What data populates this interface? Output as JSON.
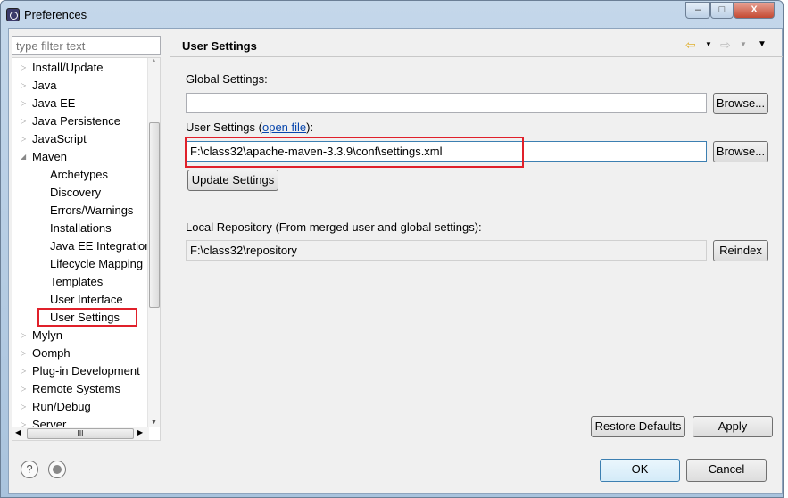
{
  "window": {
    "title": "Preferences",
    "minimize": "‒",
    "maximize": "□",
    "close": "X"
  },
  "filter": {
    "placeholder": "type filter text"
  },
  "tree": {
    "items": [
      {
        "label": "Install/Update",
        "level": 0,
        "expanded": false
      },
      {
        "label": "Java",
        "level": 0,
        "expanded": false
      },
      {
        "label": "Java EE",
        "level": 0,
        "expanded": false
      },
      {
        "label": "Java Persistence",
        "level": 0,
        "expanded": false
      },
      {
        "label": "JavaScript",
        "level": 0,
        "expanded": false
      },
      {
        "label": "Maven",
        "level": 0,
        "expanded": true
      },
      {
        "label": "Archetypes",
        "level": 1
      },
      {
        "label": "Discovery",
        "level": 1
      },
      {
        "label": "Errors/Warnings",
        "level": 1
      },
      {
        "label": "Installations",
        "level": 1
      },
      {
        "label": "Java EE Integration",
        "level": 1
      },
      {
        "label": "Lifecycle Mapping",
        "level": 1
      },
      {
        "label": "Templates",
        "level": 1
      },
      {
        "label": "User Interface",
        "level": 1
      },
      {
        "label": "User Settings",
        "level": 1,
        "selected": true
      },
      {
        "label": "Mylyn",
        "level": 0,
        "expanded": false
      },
      {
        "label": "Oomph",
        "level": 0,
        "expanded": false
      },
      {
        "label": "Plug-in Development",
        "level": 0,
        "expanded": false
      },
      {
        "label": "Remote Systems",
        "level": 0,
        "expanded": false
      },
      {
        "label": "Run/Debug",
        "level": 0,
        "expanded": false
      },
      {
        "label": "Server",
        "level": 0,
        "expanded": false
      }
    ],
    "hscroll_grip": "III"
  },
  "page": {
    "title": "User Settings",
    "global_label": "Global Settings:",
    "global_value": "",
    "browse": "Browse...",
    "user_label_pre": "User Settings (",
    "user_link": "open file",
    "user_label_post": "):",
    "user_value": "F:\\class32\\apache-maven-3.3.9\\conf\\settings.xml",
    "update": "Update Settings",
    "local_label": "Local Repository (From merged user and global settings):",
    "local_value": "F:\\class32\\repository",
    "reindex": "Reindex",
    "restore": "Restore Defaults",
    "apply": "Apply"
  },
  "footer": {
    "help": "?",
    "ok": "OK",
    "cancel": "Cancel"
  },
  "colors": {
    "highlight": "#e0202a",
    "back_arrow": "#f0c040"
  }
}
